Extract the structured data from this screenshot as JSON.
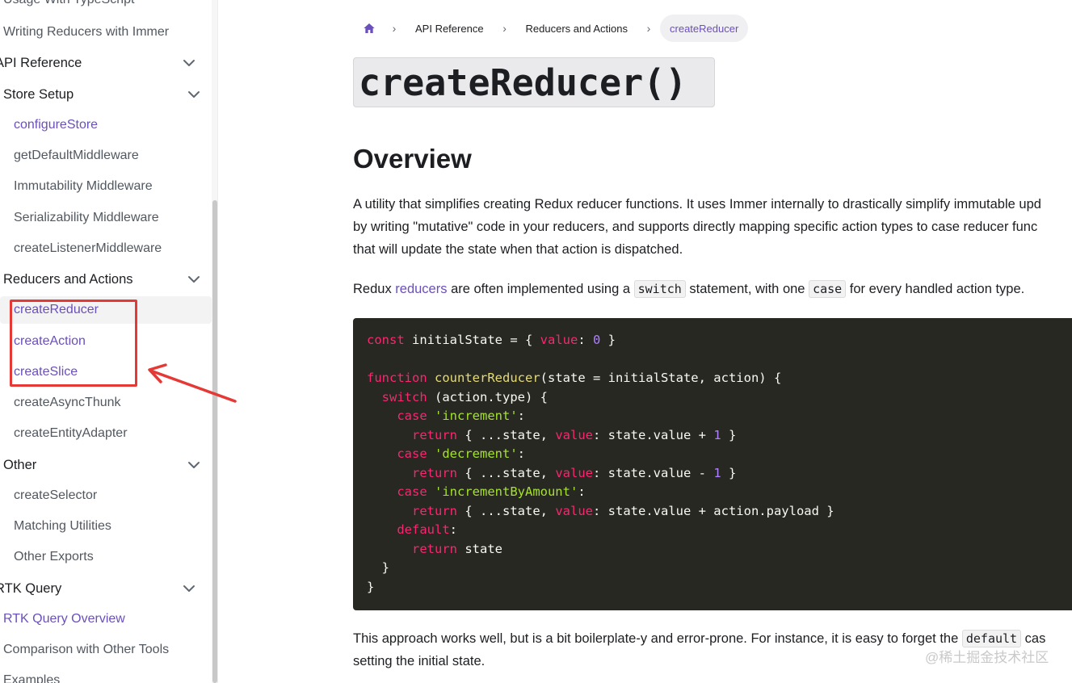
{
  "sidebar": {
    "items": [
      {
        "label": "Usage With TypeScript",
        "kind": "plain-top"
      },
      {
        "label": "Writing Reducers with Immer",
        "kind": "plain-top"
      },
      {
        "label": "API Reference",
        "kind": "cat-clip"
      },
      {
        "label": "Store Setup",
        "kind": "cat"
      },
      {
        "label": "configureStore",
        "kind": "link-sub"
      },
      {
        "label": "getDefaultMiddleware",
        "kind": "sub"
      },
      {
        "label": "Immutability Middleware",
        "kind": "sub"
      },
      {
        "label": "Serializability Middleware",
        "kind": "sub"
      },
      {
        "label": "createListenerMiddleware",
        "kind": "sub"
      },
      {
        "label": "Reducers and Actions",
        "kind": "cat"
      },
      {
        "label": "createReducer",
        "kind": "active-sub"
      },
      {
        "label": "createAction",
        "kind": "link-sub"
      },
      {
        "label": "createSlice",
        "kind": "link-sub"
      },
      {
        "label": "createAsyncThunk",
        "kind": "sub"
      },
      {
        "label": "createEntityAdapter",
        "kind": "sub"
      },
      {
        "label": "Other",
        "kind": "cat"
      },
      {
        "label": "createSelector",
        "kind": "sub"
      },
      {
        "label": "Matching Utilities",
        "kind": "sub"
      },
      {
        "label": "Other Exports",
        "kind": "sub"
      },
      {
        "label": "RTK Query",
        "kind": "cat-clip"
      },
      {
        "label": "RTK Query Overview",
        "kind": "link-top"
      },
      {
        "label": "Comparison with Other Tools",
        "kind": "plain-top"
      },
      {
        "label": "Examples",
        "kind": "plain-top"
      }
    ]
  },
  "breadcrumb": {
    "home_icon": "home-icon",
    "items": [
      "API Reference",
      "Reducers and Actions",
      "createReducer"
    ]
  },
  "page": {
    "title": "createReducer()",
    "overview_heading": "Overview",
    "para1_line1": "A utility that simplifies creating Redux reducer functions. It uses Immer internally to drastically simplify immutable upd",
    "para1_line2": "by writing \"mutative\" code in your reducers, and supports directly mapping specific action types to case reducer func",
    "para1_line3": "that will update the state when that action is dispatched.",
    "para2_a": "Redux ",
    "para2_link": "reducers",
    "para2_b": " are often implemented using a ",
    "para2_code1": "switch",
    "para2_c": " statement, with one ",
    "para2_code2": "case",
    "para2_d": " for every handled action type.",
    "para3_line1_a": "This approach works well, but is a bit boilerplate-y and error-prone. For instance, it is easy to forget the ",
    "para3_code": "default",
    "para3_line1_b": " cas",
    "para3_line2": "setting the initial state."
  },
  "code": {
    "l1_kw": "const",
    "l1_rest": " initialState = { ",
    "l1_prop": "value",
    "l1_colon": ": ",
    "l1_num": "0",
    "l1_end": " }",
    "l3_kw": "function",
    "l3_fn": "counterReducer",
    "l3_rest": "(state = initialState, action) {",
    "l4_kw": "switch",
    "l4_rest": " (action.type) {",
    "l5_kw": "case",
    "l5_str": "'increment'",
    "l5_end": ":",
    "l6_kw": "return",
    "l6_a": " { ...state, ",
    "l6_prop": "value",
    "l6_b": ": state.value + ",
    "l6_num": "1",
    "l6_end": " }",
    "l7_kw": "case",
    "l7_str": "'decrement'",
    "l7_end": ":",
    "l8_kw": "return",
    "l8_a": " { ...state, ",
    "l8_prop": "value",
    "l8_b": ": state.value - ",
    "l8_num": "1",
    "l8_end": " }",
    "l9_kw": "case",
    "l9_str": "'incrementByAmount'",
    "l9_end": ":",
    "l10_kw": "return",
    "l10_a": " { ...state, ",
    "l10_prop": "value",
    "l10_b": ": state.value + action.payload }",
    "l11_kw": "default",
    "l11_end": ":",
    "l12_kw": "return",
    "l12_rest": " state",
    "l13": "}",
    "l14": "}"
  },
  "watermark": "@稀土掘金技术社区",
  "colors": {
    "accent": "#6b4fbb",
    "code_bg": "#272822",
    "annotation": "#e53935"
  }
}
